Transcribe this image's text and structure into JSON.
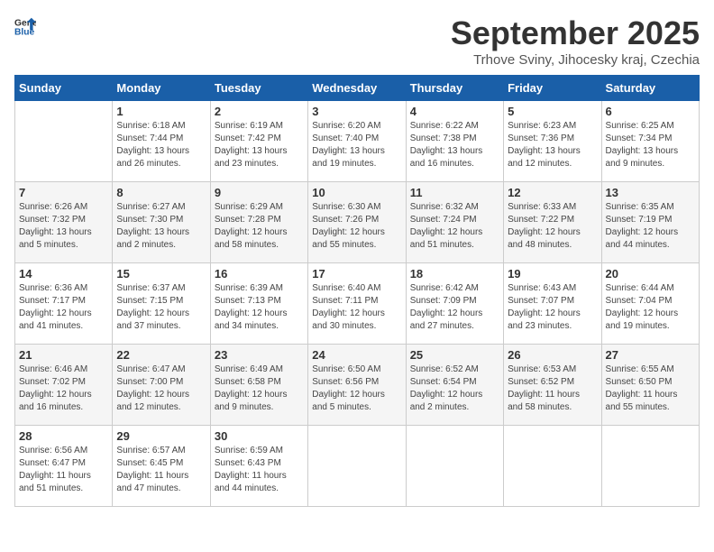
{
  "header": {
    "logo_line1": "General",
    "logo_line2": "Blue",
    "month_title": "September 2025",
    "location": "Trhove Sviny, Jihocesky kraj, Czechia"
  },
  "weekdays": [
    "Sunday",
    "Monday",
    "Tuesday",
    "Wednesday",
    "Thursday",
    "Friday",
    "Saturday"
  ],
  "weeks": [
    [
      {
        "day": "",
        "info": ""
      },
      {
        "day": "1",
        "info": "Sunrise: 6:18 AM\nSunset: 7:44 PM\nDaylight: 13 hours\nand 26 minutes."
      },
      {
        "day": "2",
        "info": "Sunrise: 6:19 AM\nSunset: 7:42 PM\nDaylight: 13 hours\nand 23 minutes."
      },
      {
        "day": "3",
        "info": "Sunrise: 6:20 AM\nSunset: 7:40 PM\nDaylight: 13 hours\nand 19 minutes."
      },
      {
        "day": "4",
        "info": "Sunrise: 6:22 AM\nSunset: 7:38 PM\nDaylight: 13 hours\nand 16 minutes."
      },
      {
        "day": "5",
        "info": "Sunrise: 6:23 AM\nSunset: 7:36 PM\nDaylight: 13 hours\nand 12 minutes."
      },
      {
        "day": "6",
        "info": "Sunrise: 6:25 AM\nSunset: 7:34 PM\nDaylight: 13 hours\nand 9 minutes."
      }
    ],
    [
      {
        "day": "7",
        "info": "Sunrise: 6:26 AM\nSunset: 7:32 PM\nDaylight: 13 hours\nand 5 minutes."
      },
      {
        "day": "8",
        "info": "Sunrise: 6:27 AM\nSunset: 7:30 PM\nDaylight: 13 hours\nand 2 minutes."
      },
      {
        "day": "9",
        "info": "Sunrise: 6:29 AM\nSunset: 7:28 PM\nDaylight: 12 hours\nand 58 minutes."
      },
      {
        "day": "10",
        "info": "Sunrise: 6:30 AM\nSunset: 7:26 PM\nDaylight: 12 hours\nand 55 minutes."
      },
      {
        "day": "11",
        "info": "Sunrise: 6:32 AM\nSunset: 7:24 PM\nDaylight: 12 hours\nand 51 minutes."
      },
      {
        "day": "12",
        "info": "Sunrise: 6:33 AM\nSunset: 7:22 PM\nDaylight: 12 hours\nand 48 minutes."
      },
      {
        "day": "13",
        "info": "Sunrise: 6:35 AM\nSunset: 7:19 PM\nDaylight: 12 hours\nand 44 minutes."
      }
    ],
    [
      {
        "day": "14",
        "info": "Sunrise: 6:36 AM\nSunset: 7:17 PM\nDaylight: 12 hours\nand 41 minutes."
      },
      {
        "day": "15",
        "info": "Sunrise: 6:37 AM\nSunset: 7:15 PM\nDaylight: 12 hours\nand 37 minutes."
      },
      {
        "day": "16",
        "info": "Sunrise: 6:39 AM\nSunset: 7:13 PM\nDaylight: 12 hours\nand 34 minutes."
      },
      {
        "day": "17",
        "info": "Sunrise: 6:40 AM\nSunset: 7:11 PM\nDaylight: 12 hours\nand 30 minutes."
      },
      {
        "day": "18",
        "info": "Sunrise: 6:42 AM\nSunset: 7:09 PM\nDaylight: 12 hours\nand 27 minutes."
      },
      {
        "day": "19",
        "info": "Sunrise: 6:43 AM\nSunset: 7:07 PM\nDaylight: 12 hours\nand 23 minutes."
      },
      {
        "day": "20",
        "info": "Sunrise: 6:44 AM\nSunset: 7:04 PM\nDaylight: 12 hours\nand 19 minutes."
      }
    ],
    [
      {
        "day": "21",
        "info": "Sunrise: 6:46 AM\nSunset: 7:02 PM\nDaylight: 12 hours\nand 16 minutes."
      },
      {
        "day": "22",
        "info": "Sunrise: 6:47 AM\nSunset: 7:00 PM\nDaylight: 12 hours\nand 12 minutes."
      },
      {
        "day": "23",
        "info": "Sunrise: 6:49 AM\nSunset: 6:58 PM\nDaylight: 12 hours\nand 9 minutes."
      },
      {
        "day": "24",
        "info": "Sunrise: 6:50 AM\nSunset: 6:56 PM\nDaylight: 12 hours\nand 5 minutes."
      },
      {
        "day": "25",
        "info": "Sunrise: 6:52 AM\nSunset: 6:54 PM\nDaylight: 12 hours\nand 2 minutes."
      },
      {
        "day": "26",
        "info": "Sunrise: 6:53 AM\nSunset: 6:52 PM\nDaylight: 11 hours\nand 58 minutes."
      },
      {
        "day": "27",
        "info": "Sunrise: 6:55 AM\nSunset: 6:50 PM\nDaylight: 11 hours\nand 55 minutes."
      }
    ],
    [
      {
        "day": "28",
        "info": "Sunrise: 6:56 AM\nSunset: 6:47 PM\nDaylight: 11 hours\nand 51 minutes."
      },
      {
        "day": "29",
        "info": "Sunrise: 6:57 AM\nSunset: 6:45 PM\nDaylight: 11 hours\nand 47 minutes."
      },
      {
        "day": "30",
        "info": "Sunrise: 6:59 AM\nSunset: 6:43 PM\nDaylight: 11 hours\nand 44 minutes."
      },
      {
        "day": "",
        "info": ""
      },
      {
        "day": "",
        "info": ""
      },
      {
        "day": "",
        "info": ""
      },
      {
        "day": "",
        "info": ""
      }
    ]
  ]
}
